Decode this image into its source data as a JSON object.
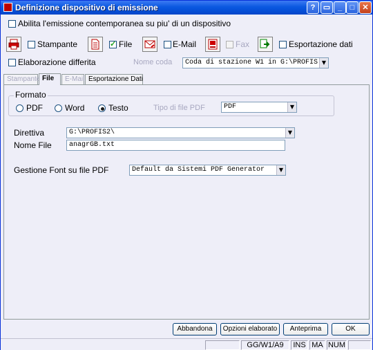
{
  "window": {
    "title": "Definizione dispositivo di emissione",
    "controls": {
      "minimize": "_",
      "maximize": "□",
      "close": "✕"
    }
  },
  "options": {
    "multi_device_label": "Abilita l'emissione contemporanea su piu' di un dispositivo",
    "multi_device_checked": false
  },
  "devices": [
    {
      "label": "Stampante",
      "icon": "printer-icon",
      "checked": false,
      "enabled": true
    },
    {
      "label": "File",
      "icon": "file-icon",
      "checked": true,
      "enabled": true
    },
    {
      "label": "E-Mail",
      "icon": "email-icon",
      "checked": false,
      "enabled": true
    },
    {
      "label": "Fax",
      "icon": "fax-icon",
      "checked": false,
      "enabled": false
    },
    {
      "label": "Esportazione dati",
      "icon": "export-icon",
      "checked": false,
      "enabled": true
    }
  ],
  "deferred": {
    "label": "Elaborazione differita",
    "checked": false,
    "queue_label": "Nome coda",
    "queue_value": "Coda di stazione W1 in G:\\PROFIS"
  },
  "tabs": [
    {
      "label": "Stampante",
      "enabled": false,
      "active": false
    },
    {
      "label": "File",
      "enabled": true,
      "active": true
    },
    {
      "label": "E-Mail",
      "enabled": false,
      "active": false
    },
    {
      "label": "Esportazione Dati",
      "enabled": true,
      "active": false
    }
  ],
  "format": {
    "group_title": "Formato",
    "options": [
      {
        "label": "PDF",
        "selected": false
      },
      {
        "label": "Word",
        "selected": false
      },
      {
        "label": "Testo",
        "selected": true
      }
    ],
    "pdf_type_label": "Tipo di file PDF",
    "pdf_type_value": "PDF"
  },
  "fields": {
    "directory_label": "Direttiva",
    "directory_value": "G:\\PROFIS2\\",
    "filename_label": "Nome File",
    "filename_value": "anagrGB.txt",
    "font_label": "Gestione Font su file PDF",
    "font_value": "Default da Sistemi PDF Generator"
  },
  "buttons": {
    "abandon": "Abbandona",
    "options": "Opzioni elaborato",
    "preview": "Anteprima",
    "ok": "OK"
  },
  "status": {
    "path": "GG/W1/A9",
    "ins": "INS",
    "ma": "MA",
    "num": "NUM"
  },
  "colors": {
    "titlebar": "#0b58e0",
    "window_bg": "#eeeef8"
  }
}
